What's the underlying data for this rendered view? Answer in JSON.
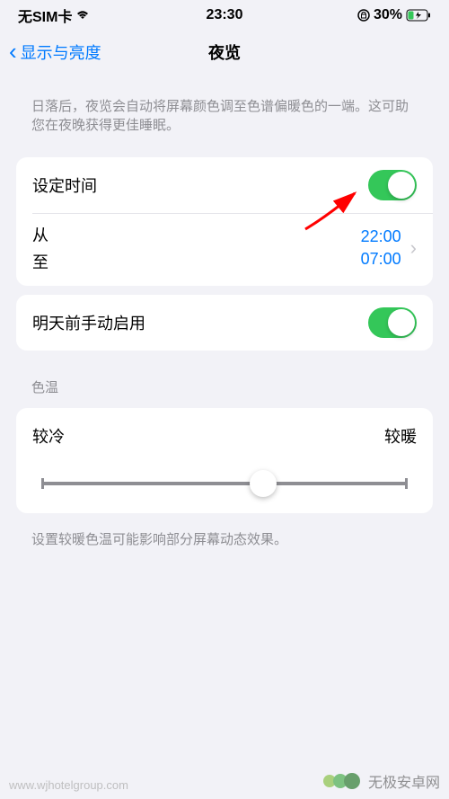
{
  "status": {
    "carrier": "无SIM卡",
    "time": "23:30",
    "battery_pct": "30%"
  },
  "nav": {
    "back_label": "显示与亮度",
    "title": "夜览"
  },
  "description": "日落后，夜览会自动将屏幕颜色调至色谱偏暖色的一端。这可助您在夜晚获得更佳睡眠。",
  "schedule": {
    "scheduled_label": "设定时间",
    "from_label": "从",
    "to_label": "至",
    "from_time": "22:00",
    "to_time": "07:00"
  },
  "manual": {
    "label": "明天前手动启用"
  },
  "temperature": {
    "header": "色温",
    "less_warm": "较冷",
    "more_warm": "较暖",
    "footer": "设置较暖色温可能影响部分屏幕动态效果。"
  },
  "watermark": {
    "url": "www.wjhotelgroup.com",
    "brand": "无极安卓网"
  }
}
